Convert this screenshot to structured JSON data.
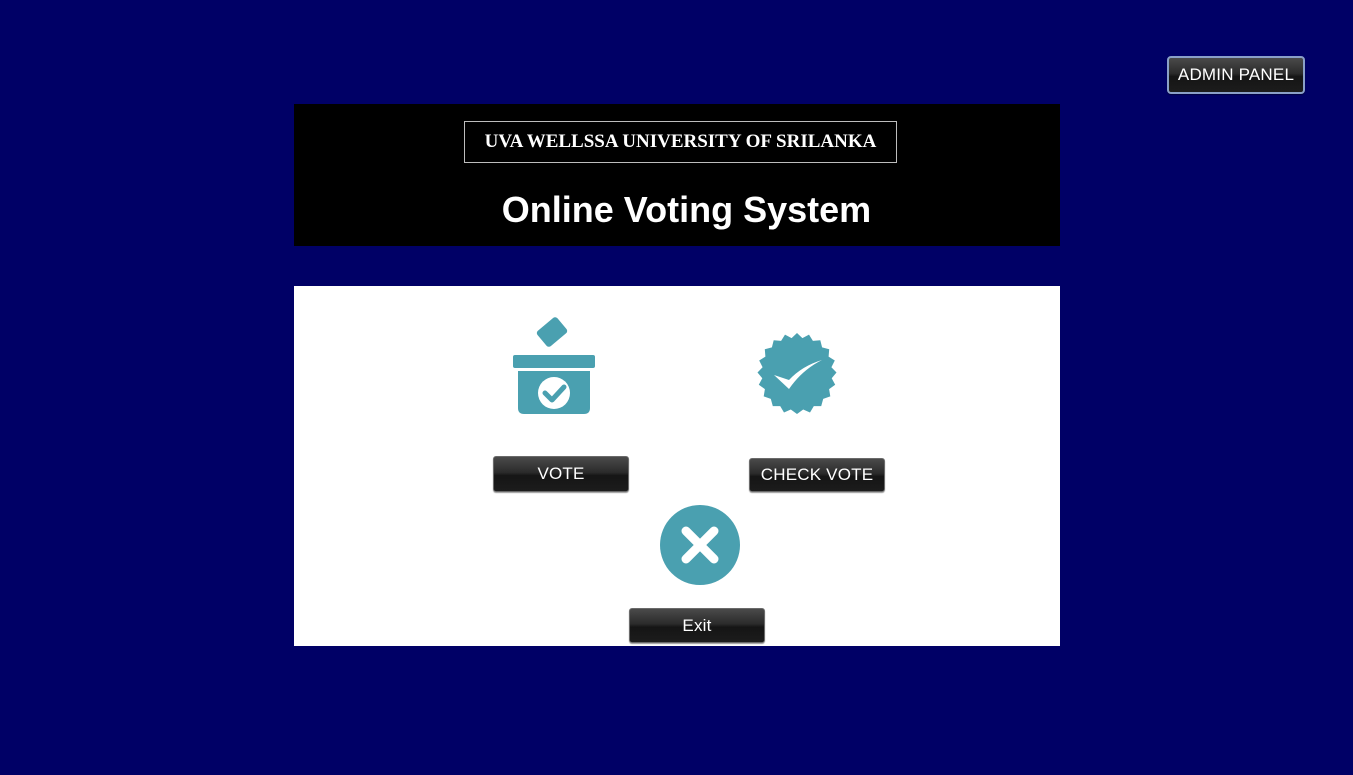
{
  "header": {
    "university_name": "UVA WELLSSA UNIVERSITY OF SRILANKA",
    "title": "Online Voting System"
  },
  "admin_panel_label": "ADMIN PANEL",
  "actions": {
    "vote_label": "VOTE",
    "check_vote_label": "CHECK VOTE",
    "exit_label": "Exit"
  },
  "icons": {
    "vote": "ballot-box-icon",
    "check_vote": "verified-badge-icon",
    "exit": "close-circle-icon"
  },
  "colors": {
    "background": "#000066",
    "header_background": "#000000",
    "panel_background": "#ffffff",
    "icon_accent": "#4aa0b0"
  }
}
